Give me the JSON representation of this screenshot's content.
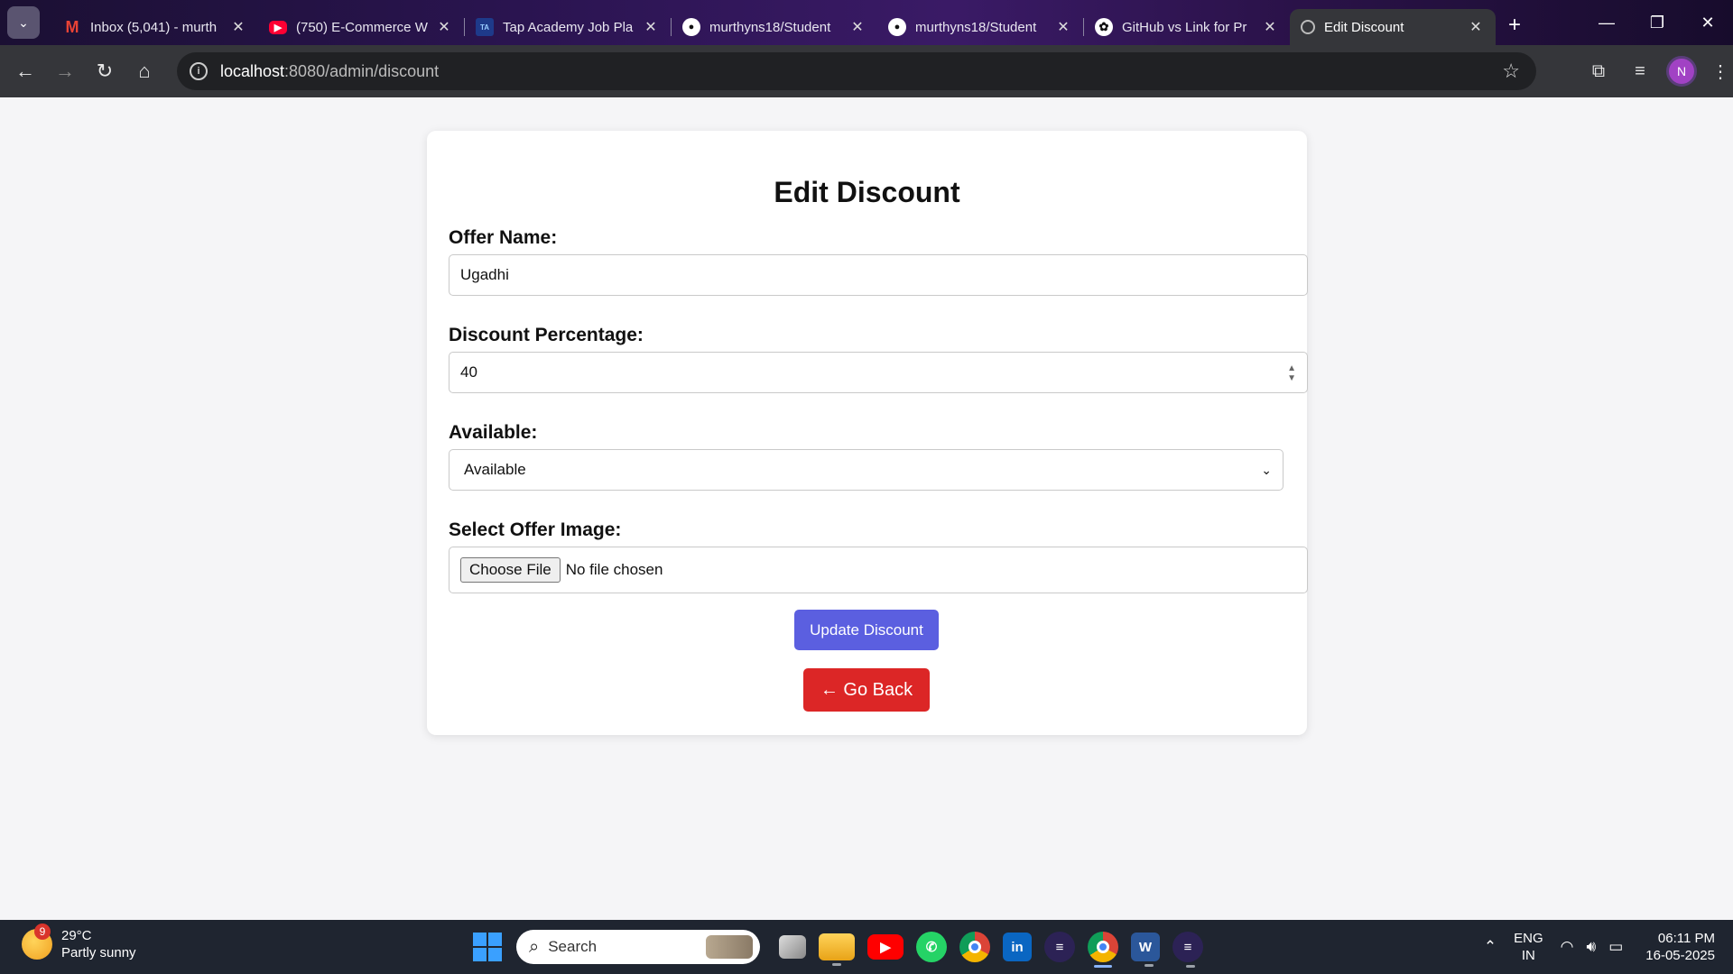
{
  "browser": {
    "tabs": [
      {
        "title": "Inbox (5,041) - murth",
        "icon": "gmail-icon",
        "color": "#ea4335"
      },
      {
        "title": "(750) E-Commerce W",
        "icon": "youtube-icon",
        "color": "#ff0033"
      },
      {
        "title": "Tap Academy Job Pla",
        "icon": "tapacademy-icon",
        "color": "#1e3a8a"
      },
      {
        "title": "murthyns18/Student",
        "icon": "github-icon",
        "color": "#ffffff"
      },
      {
        "title": "murthyns18/Student",
        "icon": "github-icon",
        "color": "#ffffff"
      },
      {
        "title": "GitHub vs Link for Pr",
        "icon": "chatgpt-icon",
        "color": "#ffffff"
      },
      {
        "title": "Edit Discount",
        "icon": "globe-icon",
        "color": "#cccccc",
        "active": true
      }
    ],
    "url_host": "localhost",
    "url_path": ":8080/admin/discount",
    "profile_initial": "N"
  },
  "form": {
    "title": "Edit Discount",
    "offer_name_label": "Offer Name:",
    "offer_name_value": "Ugadhi",
    "discount_label": "Discount Percentage:",
    "discount_value": "40",
    "available_label": "Available:",
    "available_selected": "Available",
    "image_label": "Select Offer Image:",
    "choose_file_label": "Choose File",
    "file_status": "No file chosen",
    "update_button": "Update Discount",
    "back_button": "← Go Back"
  },
  "colors": {
    "update_button": "#5b5fe0",
    "back_button": "#dc2626"
  },
  "taskbar": {
    "weather_badge": "9",
    "temperature": "29°C",
    "condition": "Partly sunny",
    "search_placeholder": "Search",
    "apps": [
      "file-explorer-icon",
      "youtube-icon",
      "whatsapp-icon",
      "chrome-icon",
      "linkedin-icon",
      "eclipse-icon",
      "chrome-profile-icon",
      "word-icon",
      "eclipse-icon"
    ],
    "lang_line1": "ENG",
    "lang_line2": "IN",
    "time": "06:11 PM",
    "date": "16-05-2025"
  }
}
